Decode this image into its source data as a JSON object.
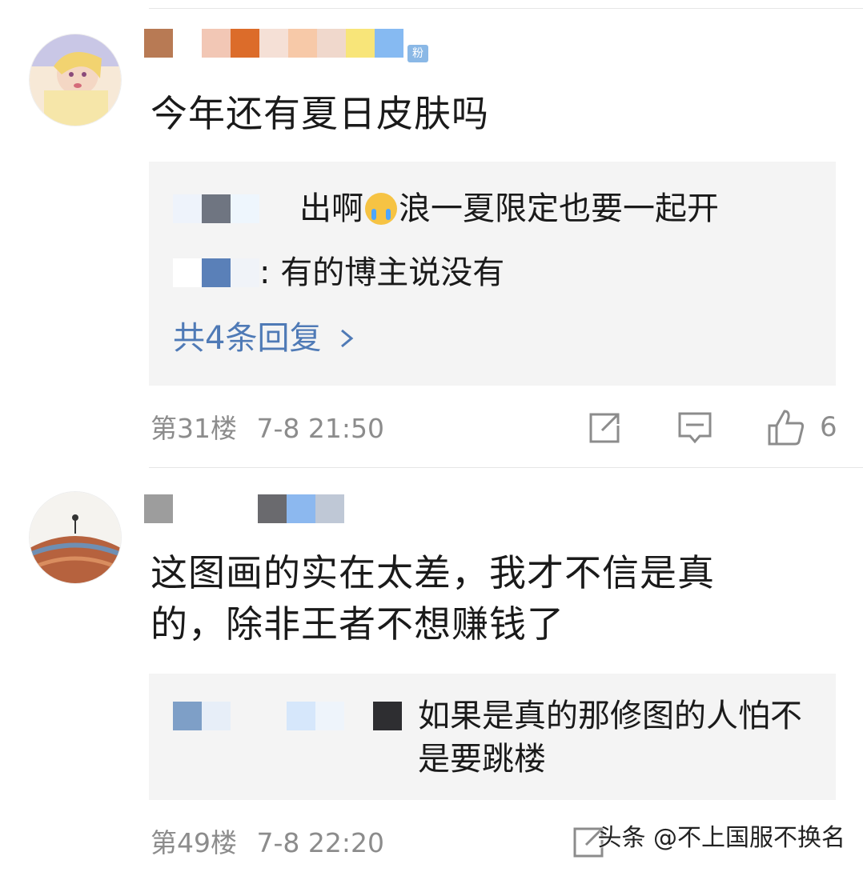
{
  "comments": [
    {
      "text": "今年还有夏日皮肤吗",
      "replies": [
        {
          "text": "浪一夏限定也要一起开",
          "prefix": "出啊"
        },
        {
          "text": ": 有的博主说没有"
        }
      ],
      "more_replies": "共4条回复",
      "floor": "第31楼",
      "time": "7-8 21:50",
      "likes": "6",
      "badge": "粉"
    },
    {
      "text": "这图画的实在太差，我才不信是真的，除非王者不想赚钱了",
      "replies": [
        {
          "text": "如果是真的那修图的人怕不是要跳楼"
        }
      ],
      "floor": "第49楼",
      "time": "7-8 22:20"
    }
  ],
  "watermark": "头条 @不上国服不换名",
  "colors": {
    "link": "#4f7ab6",
    "meta": "#8c8c8c",
    "reply_bg": "#f4f4f4"
  }
}
